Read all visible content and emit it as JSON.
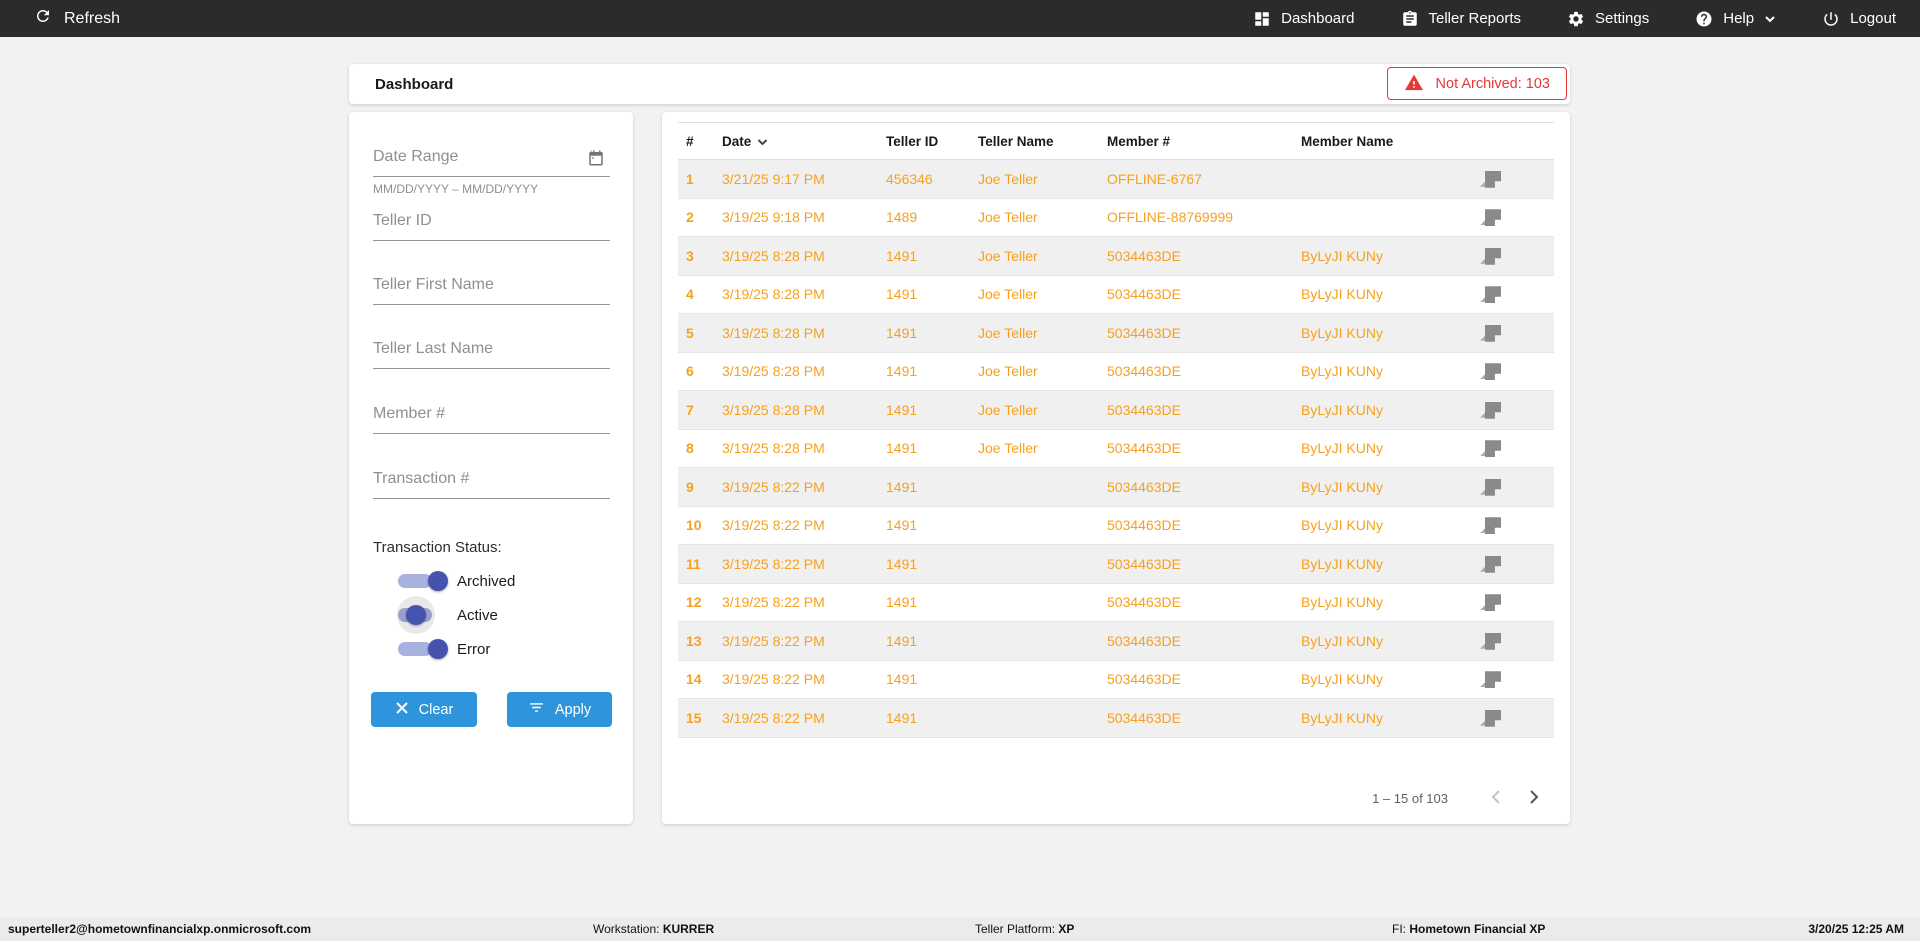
{
  "navbar": {
    "refresh_label": "Refresh",
    "items": [
      {
        "label": "Dashboard"
      },
      {
        "label": "Teller Reports"
      },
      {
        "label": "Settings"
      },
      {
        "label": "Help"
      },
      {
        "label": "Logout"
      }
    ]
  },
  "header": {
    "title": "Dashboard",
    "badge": "Not Archived: 103"
  },
  "filters": {
    "date_range": {
      "label": "Date Range",
      "hint": "MM/DD/YYYY – MM/DD/YYYY"
    },
    "fields": [
      {
        "label": "Teller ID"
      },
      {
        "label": "Teller First Name"
      },
      {
        "label": "Teller Last Name"
      },
      {
        "label": "Member #"
      },
      {
        "label": "Transaction #"
      }
    ],
    "status": {
      "label": "Transaction Status:",
      "toggles": [
        {
          "label": "Archived",
          "state": "on"
        },
        {
          "label": "Active",
          "state": "off-focus"
        },
        {
          "label": "Error",
          "state": "on"
        }
      ]
    },
    "clear_label": "Clear",
    "apply_label": "Apply"
  },
  "table": {
    "columns": [
      "#",
      "Date",
      "Teller ID",
      "Teller Name",
      "Member #",
      "Member Name"
    ],
    "sort_column": "Date",
    "sort_direction": "desc",
    "rows": [
      {
        "num": "1",
        "date": "3/21/25 9:17 PM",
        "teller_id": "456346",
        "teller_name": "Joe Teller",
        "member_num": "OFFLINE-6767",
        "member_name": ""
      },
      {
        "num": "2",
        "date": "3/19/25 9:18 PM",
        "teller_id": "1489",
        "teller_name": "Joe Teller",
        "member_num": "OFFLINE-88769999",
        "member_name": ""
      },
      {
        "num": "3",
        "date": "3/19/25 8:28 PM",
        "teller_id": "1491",
        "teller_name": "Joe Teller",
        "member_num": "5034463DE",
        "member_name": "ByLyJI KUNy"
      },
      {
        "num": "4",
        "date": "3/19/25 8:28 PM",
        "teller_id": "1491",
        "teller_name": "Joe Teller",
        "member_num": "5034463DE",
        "member_name": "ByLyJI KUNy"
      },
      {
        "num": "5",
        "date": "3/19/25 8:28 PM",
        "teller_id": "1491",
        "teller_name": "Joe Teller",
        "member_num": "5034463DE",
        "member_name": "ByLyJI KUNy"
      },
      {
        "num": "6",
        "date": "3/19/25 8:28 PM",
        "teller_id": "1491",
        "teller_name": "Joe Teller",
        "member_num": "5034463DE",
        "member_name": "ByLyJI KUNy"
      },
      {
        "num": "7",
        "date": "3/19/25 8:28 PM",
        "teller_id": "1491",
        "teller_name": "Joe Teller",
        "member_num": "5034463DE",
        "member_name": "ByLyJI KUNy"
      },
      {
        "num": "8",
        "date": "3/19/25 8:28 PM",
        "teller_id": "1491",
        "teller_name": "Joe Teller",
        "member_num": "5034463DE",
        "member_name": "ByLyJI KUNy"
      },
      {
        "num": "9",
        "date": "3/19/25 8:22 PM",
        "teller_id": "1491",
        "teller_name": "",
        "member_num": "5034463DE",
        "member_name": "ByLyJI KUNy"
      },
      {
        "num": "10",
        "date": "3/19/25 8:22 PM",
        "teller_id": "1491",
        "teller_name": "",
        "member_num": "5034463DE",
        "member_name": "ByLyJI KUNy"
      },
      {
        "num": "11",
        "date": "3/19/25 8:22 PM",
        "teller_id": "1491",
        "teller_name": "",
        "member_num": "5034463DE",
        "member_name": "ByLyJI KUNy"
      },
      {
        "num": "12",
        "date": "3/19/25 8:22 PM",
        "teller_id": "1491",
        "teller_name": "",
        "member_num": "5034463DE",
        "member_name": "ByLyJI KUNy"
      },
      {
        "num": "13",
        "date": "3/19/25 8:22 PM",
        "teller_id": "1491",
        "teller_name": "",
        "member_num": "5034463DE",
        "member_name": "ByLyJI KUNy"
      },
      {
        "num": "14",
        "date": "3/19/25 8:22 PM",
        "teller_id": "1491",
        "teller_name": "",
        "member_num": "5034463DE",
        "member_name": "ByLyJI KUNy"
      },
      {
        "num": "15",
        "date": "3/19/25 8:22 PM",
        "teller_id": "1491",
        "teller_name": "",
        "member_num": "5034463DE",
        "member_name": "ByLyJI KUNy"
      }
    ],
    "pagination": {
      "label": "1 – 15 of 103"
    }
  },
  "footer": {
    "user": "superteller2@hometownfinancialxp.onmicrosoft.com",
    "workstation_label": "Workstation:",
    "workstation": "KURRER",
    "platform_label": "Teller Platform:",
    "platform": "XP",
    "fi_label": "FI:",
    "fi": "Hometown Financial XP",
    "datetime": "3/20/25 12:25 AM"
  },
  "colors": {
    "navbar_bg": "#2B2B2B",
    "accent_orange": "#F8A01D",
    "button_blue": "#2E95DC",
    "toggle_indigo": "#4553AF",
    "badge_red": "#E53935",
    "row_stripe": "#F0F0F0"
  }
}
